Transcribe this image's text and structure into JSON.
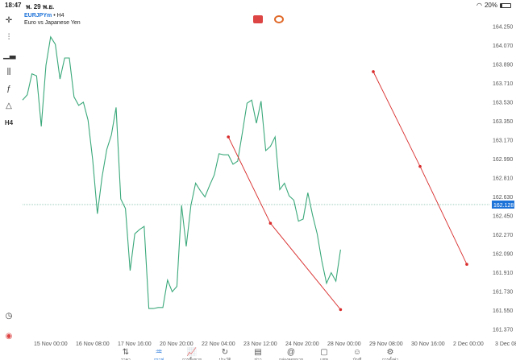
{
  "status": {
    "time": "18:47",
    "date": "พ. 29 พ.ย.",
    "battery": "20%"
  },
  "symbol": {
    "name": "EURJPYm",
    "timeframe": "• H4",
    "description": "Euro vs Japanese Yen"
  },
  "toolbar": {
    "timeframe_label": "H4"
  },
  "price_line": {
    "value": "162.128",
    "color": "#1e73d9"
  },
  "chart_data": {
    "type": "line",
    "color": "#3aa87a",
    "x_ticks": [
      "15 Nov 00:00",
      "16 Nov 08:00",
      "17 Nov 16:00",
      "20 Nov 20:00",
      "22 Nov 04:00",
      "23 Nov 12:00",
      "24 Nov 20:00",
      "28 Nov 00:00",
      "29 Nov 08:00",
      "30 Nov 16:00",
      "2 Dec 00:00",
      "3 Dec 08:00"
    ],
    "y_ticks": [
      "164.250",
      "164.070",
      "163.890",
      "163.710",
      "163.530",
      "163.350",
      "163.170",
      "162.990",
      "162.810",
      "162.630",
      "162.450",
      "162.270",
      "162.090",
      "161.910",
      "161.730",
      "161.550",
      "161.370"
    ],
    "ylim": [
      161.28,
      164.34
    ],
    "values": [
      163.55,
      163.6,
      163.8,
      163.78,
      163.3,
      163.88,
      164.15,
      164.08,
      163.75,
      163.95,
      163.95,
      163.58,
      163.5,
      163.53,
      163.36,
      162.98,
      162.47,
      162.82,
      163.08,
      163.22,
      163.48,
      162.61,
      162.52,
      161.93,
      162.28,
      162.32,
      162.35,
      161.57,
      161.57,
      161.58,
      161.58,
      161.84,
      161.73,
      161.78,
      162.55,
      162.16,
      162.55,
      162.76,
      162.69,
      162.63,
      162.74,
      162.84,
      163.04,
      163.03,
      163.03,
      162.94,
      162.97,
      163.24,
      163.52,
      163.55,
      163.33,
      163.54,
      163.07,
      163.11,
      163.2,
      162.7,
      162.76,
      162.64,
      162.6,
      162.4,
      162.42,
      162.67,
      162.46,
      162.28,
      162.02,
      161.81,
      161.91,
      161.83,
      162.13
    ],
    "x": [
      0,
      1,
      2,
      3,
      4,
      5,
      6,
      7,
      8,
      9,
      10,
      11,
      12,
      13,
      14,
      15,
      16,
      17,
      18,
      19,
      20,
      21,
      22,
      23,
      24,
      25,
      26,
      27,
      28,
      29,
      30,
      31,
      32,
      33,
      34,
      35,
      36,
      37,
      38,
      39,
      40,
      41,
      42,
      43,
      44,
      45,
      46,
      47,
      48,
      49,
      50,
      51,
      52,
      53,
      54,
      55,
      56,
      57,
      58,
      59,
      60,
      61,
      62,
      63,
      64,
      65,
      66,
      67,
      68
    ],
    "drawings": [
      {
        "x": [
          44,
          53,
          68
        ],
        "y": [
          163.2,
          162.38,
          161.56
        ],
        "color": "#d92b2b"
      },
      {
        "x": [
          75,
          85,
          95
        ],
        "y": [
          163.82,
          162.92,
          161.99
        ],
        "color": "#d92b2b"
      }
    ]
  },
  "nav": [
    {
      "label": "ราคา",
      "icon": "⇅",
      "active": false
    },
    {
      "label": "กราฟ",
      "icon": "♒",
      "active": true
    },
    {
      "label": "การซื้อขาย",
      "icon": "📈",
      "active": false
    },
    {
      "label": "ประวัติ",
      "icon": "↻",
      "active": false
    },
    {
      "label": "ข่าว",
      "icon": "▤",
      "active": false
    },
    {
      "label": "กล่องจดหมาย",
      "icon": "@",
      "active": false
    },
    {
      "label": "แชท",
      "icon": "▢",
      "active": false
    },
    {
      "label": "บัญชี",
      "icon": "☺",
      "active": false
    },
    {
      "label": "การตั้งค่า",
      "icon": "⚙",
      "active": false
    }
  ]
}
